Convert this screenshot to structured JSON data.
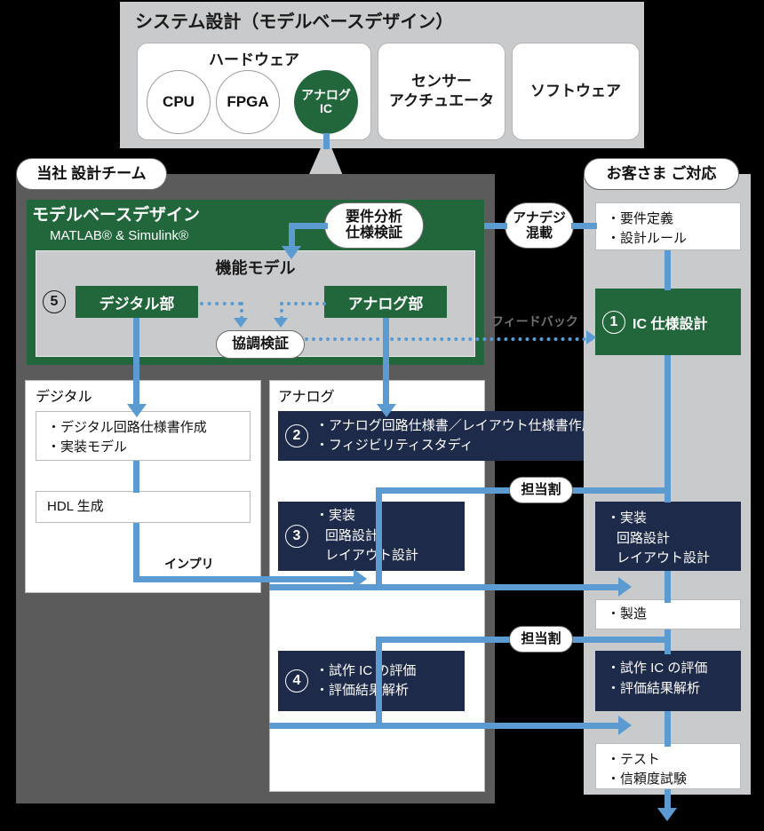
{
  "system": {
    "title": "システム設計（モデルベースデザイン）",
    "hardware_label": "ハードウェア",
    "blocks": [
      "CPU",
      "FPGA",
      "アナログ\nIC"
    ],
    "cpu": "CPU",
    "fpga": "FPGA",
    "analog_ic": "アナログ IC",
    "sensor_actuator": "センサー\nアクチュエータ",
    "software": "ソフトウェア"
  },
  "our_team": {
    "pill": "当社 設計チーム",
    "mbd_title": "モデルベースデザイン",
    "mbd_subtitle": "MATLAB® & Simulink®",
    "functional_model_label": "機能モデル",
    "step5": "⑤",
    "step5_num": "5",
    "digital_part": "デジタル部",
    "analog_part": "アナログ部",
    "coop_verify": "協調検証",
    "requirement_pill": "要件分析\n仕様検証",
    "requirement_line1": "要件分析",
    "requirement_line2": "仕様検証"
  },
  "anadeji": {
    "line1": "アナデジ",
    "line2": "混載"
  },
  "digital": {
    "head": "デジタル",
    "spec_box": "・デジタル回路仕様書作成\n・実装モデル",
    "spec_line1": "・デジタル回路仕様書作成",
    "spec_line2": "・実装モデル",
    "hdl": "HDL 生成",
    "impl_label": "インプリ"
  },
  "analog": {
    "head": "アナログ",
    "box2_num": "2",
    "box2_line1": "・アナログ回路仕様書／レイアウト仕様書作成",
    "box2_line2": "・フィジビリティスタディ",
    "box3_num": "3",
    "box3_line1": "・実装",
    "box3_line2": "回路設計",
    "box3_line3": "レイアウト設計",
    "box4_num": "4",
    "box4_line1": "・試作 IC の評価",
    "box4_line2": "・評価結果解析"
  },
  "customer": {
    "pill": "お客さま ご対応",
    "req_line1": "・要件定義",
    "req_line2": "・設計ルール",
    "step1_num": "1",
    "step1_label": "IC 仕様設計",
    "impl_line1": "・実装",
    "impl_line2": "回路設計",
    "impl_line3": "レイアウト設計",
    "manufacture": "・製造",
    "eval_line1": "・試作 IC の評価",
    "eval_line2": "・評価結果解析",
    "test_line1": "・テスト",
    "test_line2": "・信頼度試験"
  },
  "connectors": {
    "assign_label": "担当割",
    "feedback_label": "フィードバック"
  },
  "colors": {
    "green": "#22663b",
    "navy": "#1e2a4a",
    "blue_arrow": "#5b9bd1",
    "panel_grey": "#c9cacb",
    "team_grey": "#5b5b5b",
    "background": "#000000"
  }
}
